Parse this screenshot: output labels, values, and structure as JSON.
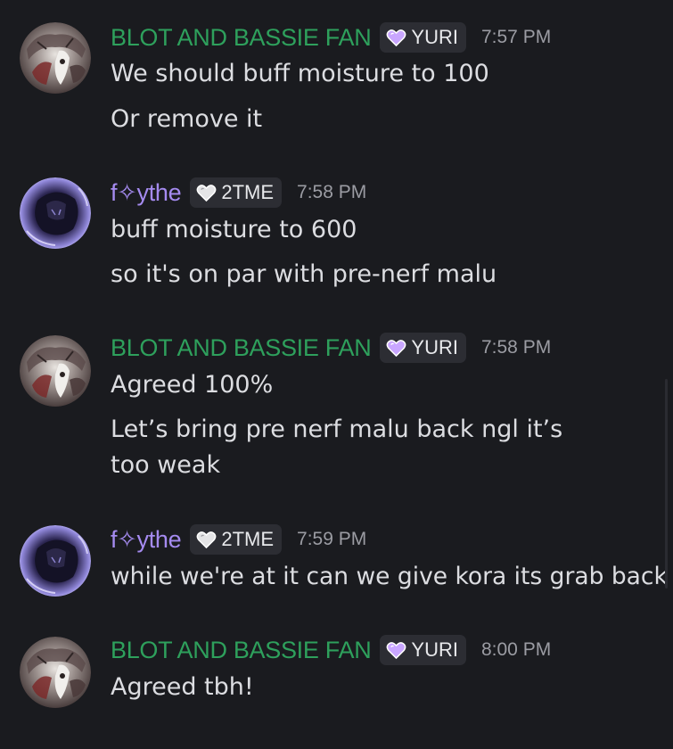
{
  "colors": {
    "background": "#1a1b1f",
    "username_blot": "#2ea05c",
    "username_fythe": "#a58bf0",
    "tag_background": "#2c2d33",
    "timestamp": "#9b9ca3",
    "message_text": "#dcdde1"
  },
  "messages": [
    {
      "author": "BLOT AND BASSIE FAN",
      "tag": "YURI",
      "tag_icon": "purple-heart-icon",
      "time": "7:57 PM",
      "lines": [
        "We should buff moisture to 100",
        "Or remove it"
      ]
    },
    {
      "author": "f✧ythe",
      "tag": "2TME",
      "tag_icon": "white-heart-icon",
      "time": "7:58 PM",
      "lines": [
        "buff moisture to 600",
        "so it's on par with pre-nerf malu"
      ]
    },
    {
      "author": "BLOT AND BASSIE FAN",
      "tag": "YURI",
      "tag_icon": "purple-heart-icon",
      "time": "7:58 PM",
      "lines": [
        "Agreed 100%",
        "Let’s bring pre nerf malu back ngl it’s too weak"
      ]
    },
    {
      "author": "f✧ythe",
      "tag": "2TME",
      "tag_icon": "white-heart-icon",
      "time": "7:59 PM",
      "lines": [
        "while we're at it can we give kora its grab back"
      ]
    },
    {
      "author": "BLOT AND BASSIE FAN",
      "tag": "YURI",
      "tag_icon": "purple-heart-icon",
      "time": "8:00 PM",
      "lines": [
        "Agreed tbh!"
      ]
    }
  ]
}
